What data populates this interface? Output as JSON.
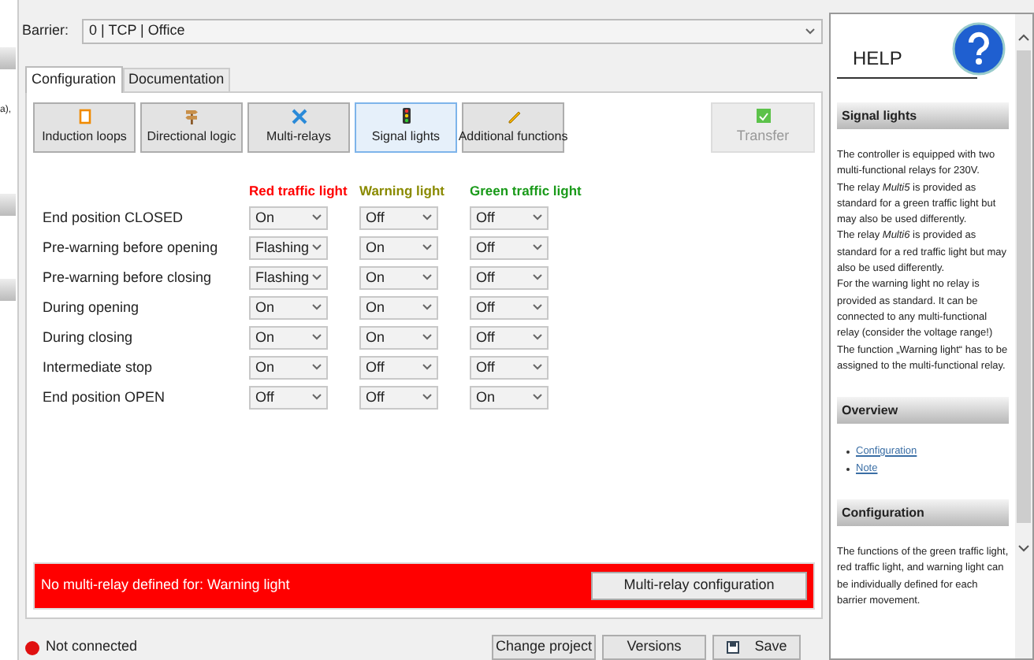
{
  "left_strip": {
    "text": "a),"
  },
  "barrier": {
    "label": "Barrier:",
    "value": "0 | TCP | Office"
  },
  "tabs": [
    {
      "label": "Configuration",
      "selected": true
    },
    {
      "label": "Documentation",
      "selected": false
    }
  ],
  "toolbar": [
    {
      "label": "Induction loops",
      "selected": false
    },
    {
      "label": "Directional logic",
      "selected": false
    },
    {
      "label": "Multi-relays",
      "selected": false
    },
    {
      "label": "Signal lights",
      "selected": true
    },
    {
      "label": "Additional functions",
      "selected": false
    }
  ],
  "transfer": {
    "label": "Transfer",
    "disabled": true
  },
  "columns": [
    {
      "label": "Red traffic light",
      "color": "#ff0000"
    },
    {
      "label": "Warning light",
      "color": "#8a8a00"
    },
    {
      "label": "Green traffic light",
      "color": "#1a9a1a"
    }
  ],
  "rows": [
    {
      "label": "End position CLOSED",
      "values": [
        "On",
        "Off",
        "Off"
      ]
    },
    {
      "label": "Pre-warning before opening",
      "values": [
        "Flashing",
        "On",
        "Off"
      ]
    },
    {
      "label": "Pre-warning before closing",
      "values": [
        "Flashing",
        "On",
        "Off"
      ]
    },
    {
      "label": "During opening",
      "values": [
        "On",
        "On",
        "Off"
      ]
    },
    {
      "label": "During closing",
      "values": [
        "On",
        "On",
        "Off"
      ]
    },
    {
      "label": "Intermediate stop",
      "values": [
        "On",
        "Off",
        "Off"
      ]
    },
    {
      "label": "End position OPEN",
      "values": [
        "Off",
        "Off",
        "On"
      ]
    }
  ],
  "warning": {
    "message": "No multi-relay defined for: Warning light",
    "button": "Multi-relay configuration"
  },
  "status": {
    "text": "Not connected",
    "connected": false
  },
  "footer_buttons": [
    "Change project",
    "Versions",
    "Save"
  ],
  "help": {
    "title": "HELP",
    "sections": [
      {
        "heading": "Signal lights",
        "paragraphs": [
          "The controller is equipped with two multi-functional relays for 230V.",
          "The relay *Multi5* is provided as standard for a green traffic light but may also be used differently.",
          "The relay *Multi6* is provided as standard for a red traffic light but may also be used differently.",
          "For the warning light no relay is provided as standard. It can be connected to any multi-functional relay (consider the voltage range!) The function „Warning light“ has to be assigned to the multi-functional relay."
        ]
      },
      {
        "heading": "Overview",
        "links": [
          "Configuration",
          "Note"
        ]
      },
      {
        "heading": "Configuration",
        "paragraphs": [
          "The functions of the green traffic light, red traffic light, and warning light can be individually defined for each barrier movement."
        ]
      }
    ]
  }
}
